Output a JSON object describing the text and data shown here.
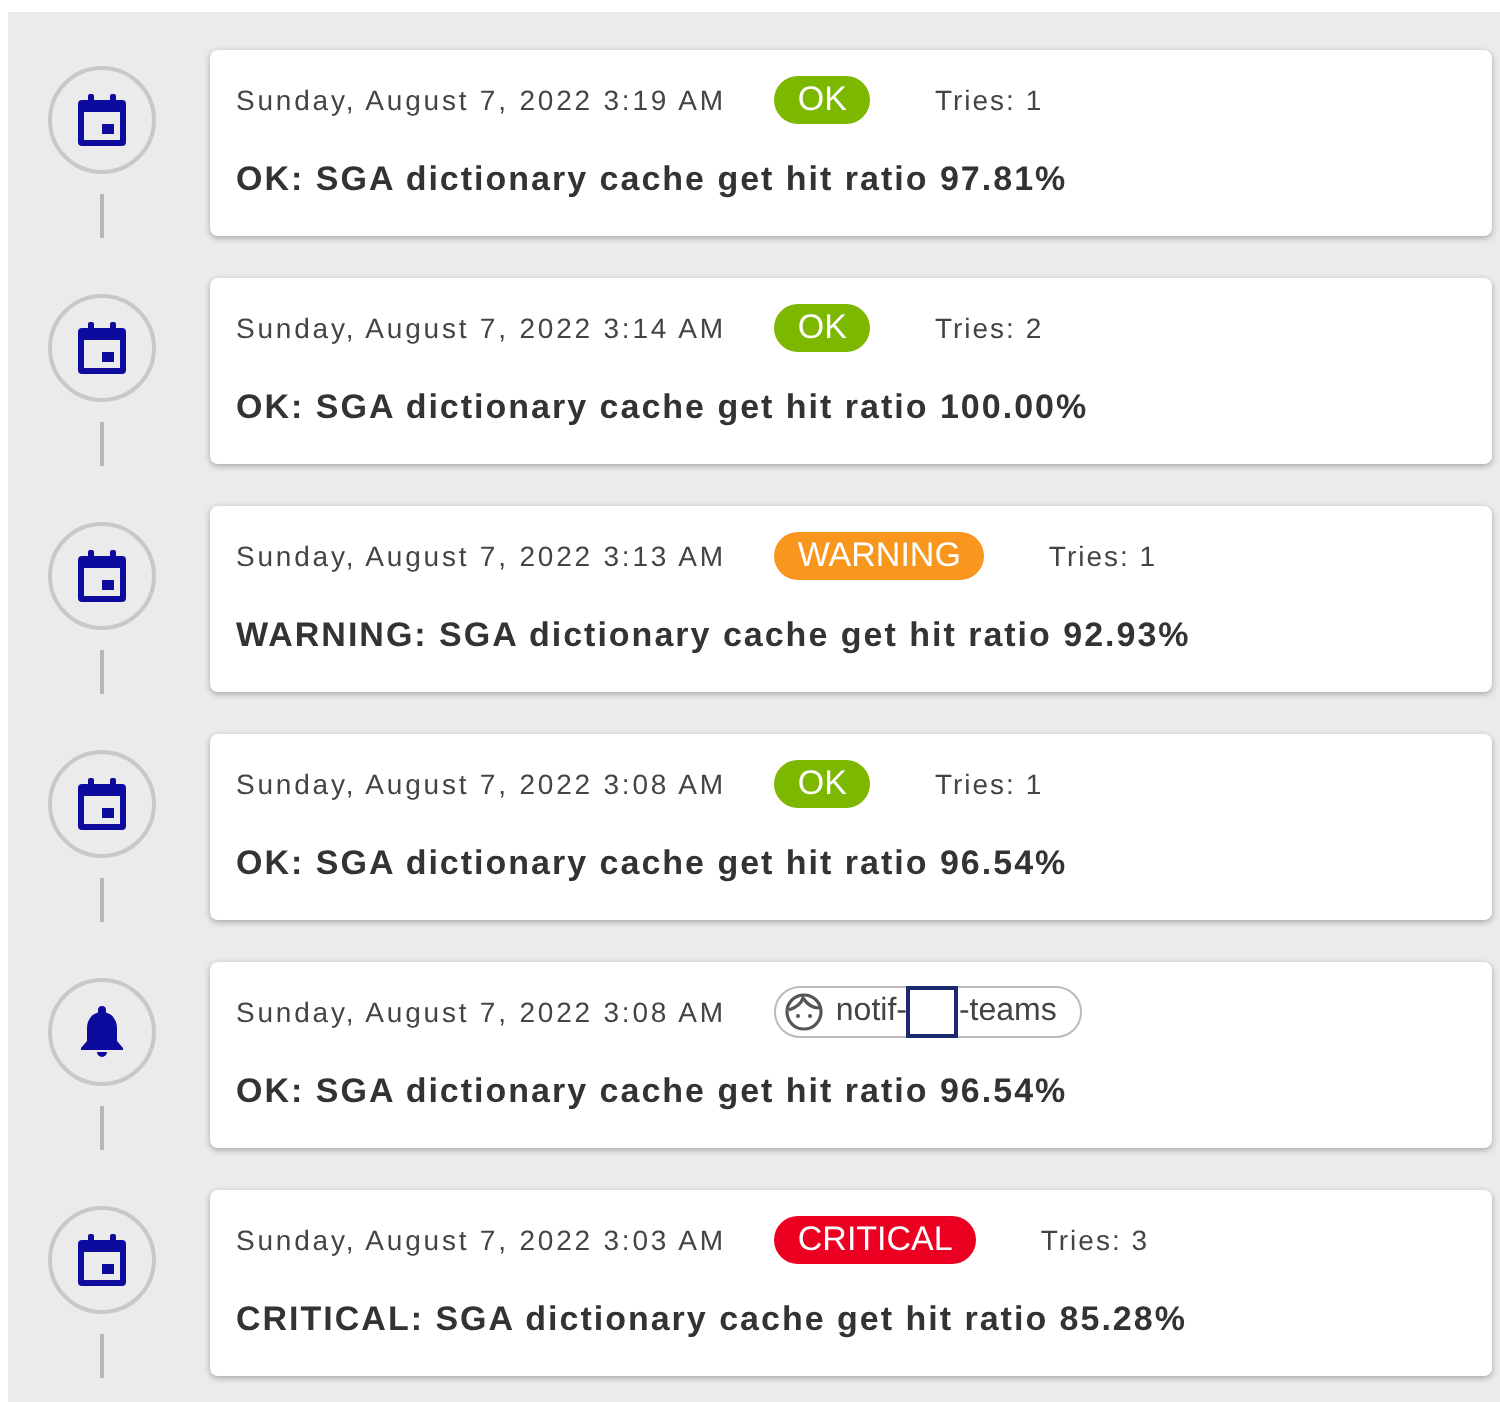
{
  "events": [
    {
      "kind": "check",
      "timestamp": "Sunday, August 7, 2022 3:19 AM",
      "status": "OK",
      "color": "#7cb800",
      "tries": "Tries: 1",
      "message": "OK: SGA dictionary cache get hit ratio 97.81%"
    },
    {
      "kind": "check",
      "timestamp": "Sunday, August 7, 2022 3:14 AM",
      "status": "OK",
      "color": "#7cb800",
      "tries": "Tries: 2",
      "message": "OK: SGA dictionary cache get hit ratio 100.00%"
    },
    {
      "kind": "check",
      "timestamp": "Sunday, August 7, 2022 3:13 AM",
      "status": "WARNING",
      "color": "#f8961e",
      "tries": "Tries: 1",
      "message": "WARNING: SGA dictionary cache get hit ratio 92.93%"
    },
    {
      "kind": "check",
      "timestamp": "Sunday, August 7, 2022 3:08 AM",
      "status": "OK",
      "color": "#7cb800",
      "tries": "Tries: 1",
      "message": "OK: SGA dictionary cache get hit ratio 96.54%"
    },
    {
      "kind": "notification",
      "timestamp": "Sunday, August 7, 2022 3:08 AM",
      "contact": {
        "before": "notif-",
        "redacted": true,
        "after": "-teams"
      },
      "message": "OK: SGA dictionary cache get hit ratio 96.54%"
    },
    {
      "kind": "check",
      "timestamp": "Sunday, August 7, 2022 3:03 AM",
      "status": "CRITICAL",
      "color": "#ec0022",
      "tries": "Tries: 3",
      "message": "CRITICAL: SGA dictionary cache get hit ratio 85.28%"
    }
  ]
}
